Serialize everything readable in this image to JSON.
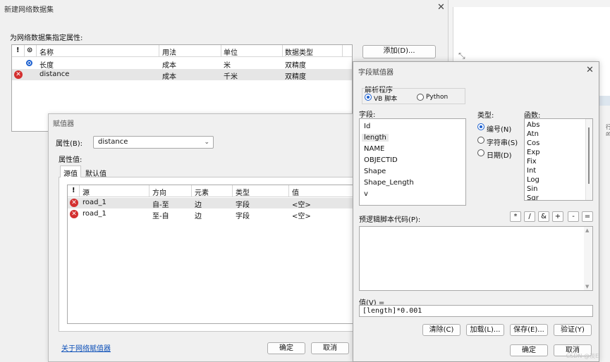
{
  "background": {
    "snippet_text": "行的"
  },
  "main_dialog": {
    "title": "新建网络数据集",
    "prompt": "为网络数据集指定属性:",
    "add_button": "添加(D)...",
    "table": {
      "headers": [
        "!",
        "⊙",
        "名称",
        "用法",
        "单位",
        "数据类型"
      ],
      "rows": [
        {
          "status": "default",
          "name": "长度",
          "usage": "成本",
          "unit": "米",
          "type": "双精度"
        },
        {
          "status": "error",
          "name": "distance",
          "usage": "成本",
          "unit": "千米",
          "type": "双精度"
        }
      ]
    }
  },
  "evaluator_dialog": {
    "title": "赋值器",
    "property_label": "属性(B):",
    "property_value": "distance",
    "property_values_label": "属性值:",
    "tabs": [
      "源值",
      "默认值"
    ],
    "table": {
      "headers": [
        "!",
        "源",
        "方向",
        "元素",
        "类型",
        "值"
      ],
      "rows": [
        {
          "source": "road_1",
          "direction": "自-至",
          "element": "边",
          "type": "字段",
          "value": "<空>"
        },
        {
          "source": "road_1",
          "direction": "至-自",
          "element": "边",
          "type": "字段",
          "value": "<空>"
        }
      ]
    },
    "link": "关于网络赋值器",
    "ok": "确定",
    "cancel": "取消"
  },
  "field_dialog": {
    "title": "字段赋值器",
    "parser_label": "解析程序",
    "parser_vb": "VB 脚本",
    "parser_python": "Python",
    "fields_label": "字段:",
    "fields": [
      "Id",
      "length",
      "NAME",
      "OBJECTID",
      "Shape",
      "Shape_Length",
      "v"
    ],
    "type_label": "类型:",
    "types": [
      "编号(N)",
      "字符串(S)",
      "日期(D)"
    ],
    "functions_label": "函数:",
    "functions": [
      "Abs",
      "Atn",
      "Cos",
      "Exp",
      "Fix",
      "Int",
      "Log",
      "Sin",
      "Sqr"
    ],
    "prelogic_label": "预逻辑脚本代码(P):",
    "operators": [
      "*",
      "/",
      "&",
      "+",
      "-",
      "="
    ],
    "value_label": "值(V) =",
    "value_expression": "[length]*0.001",
    "buttons": {
      "clear": "清除(C)",
      "load": "加载(L)...",
      "save": "保存(E)...",
      "verify": "验证(Y)"
    },
    "ok": "确定",
    "cancel": "取消"
  },
  "watermark": "CSDN @淡E"
}
